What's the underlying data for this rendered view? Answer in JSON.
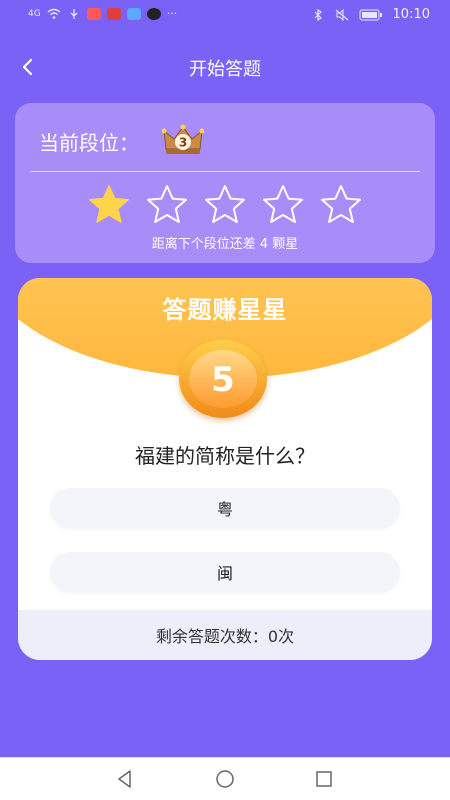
{
  "status_bar": {
    "time": "10:10",
    "signal_text": "4G",
    "more": "···",
    "icons": [
      "signal-icon",
      "wifi-icon",
      "usb-icon",
      "app-badge-red",
      "app-badge-red2",
      "app-badge-blue",
      "tiktok-icon",
      "bluetooth-icon",
      "mute-icon",
      "battery-icon"
    ]
  },
  "header": {
    "title": "开始答题"
  },
  "rank": {
    "label": "当前段位：",
    "level": "3",
    "stars_total": 5,
    "stars_filled": 1,
    "hint": "距离下个段位还差 4 颗星"
  },
  "quiz": {
    "title": "答题赚星星",
    "countdown": "5",
    "question": "福建的简称是什么？",
    "options": [
      "粤",
      "闽"
    ],
    "remaining_label": "剩余答题次数：0次"
  },
  "colors": {
    "background": "#7b62f6",
    "rank_card": "#a88df9",
    "star_filled": "#ffd34a",
    "header_gradient_top": "#ffd873",
    "header_gradient_bottom": "#ffb73d"
  }
}
